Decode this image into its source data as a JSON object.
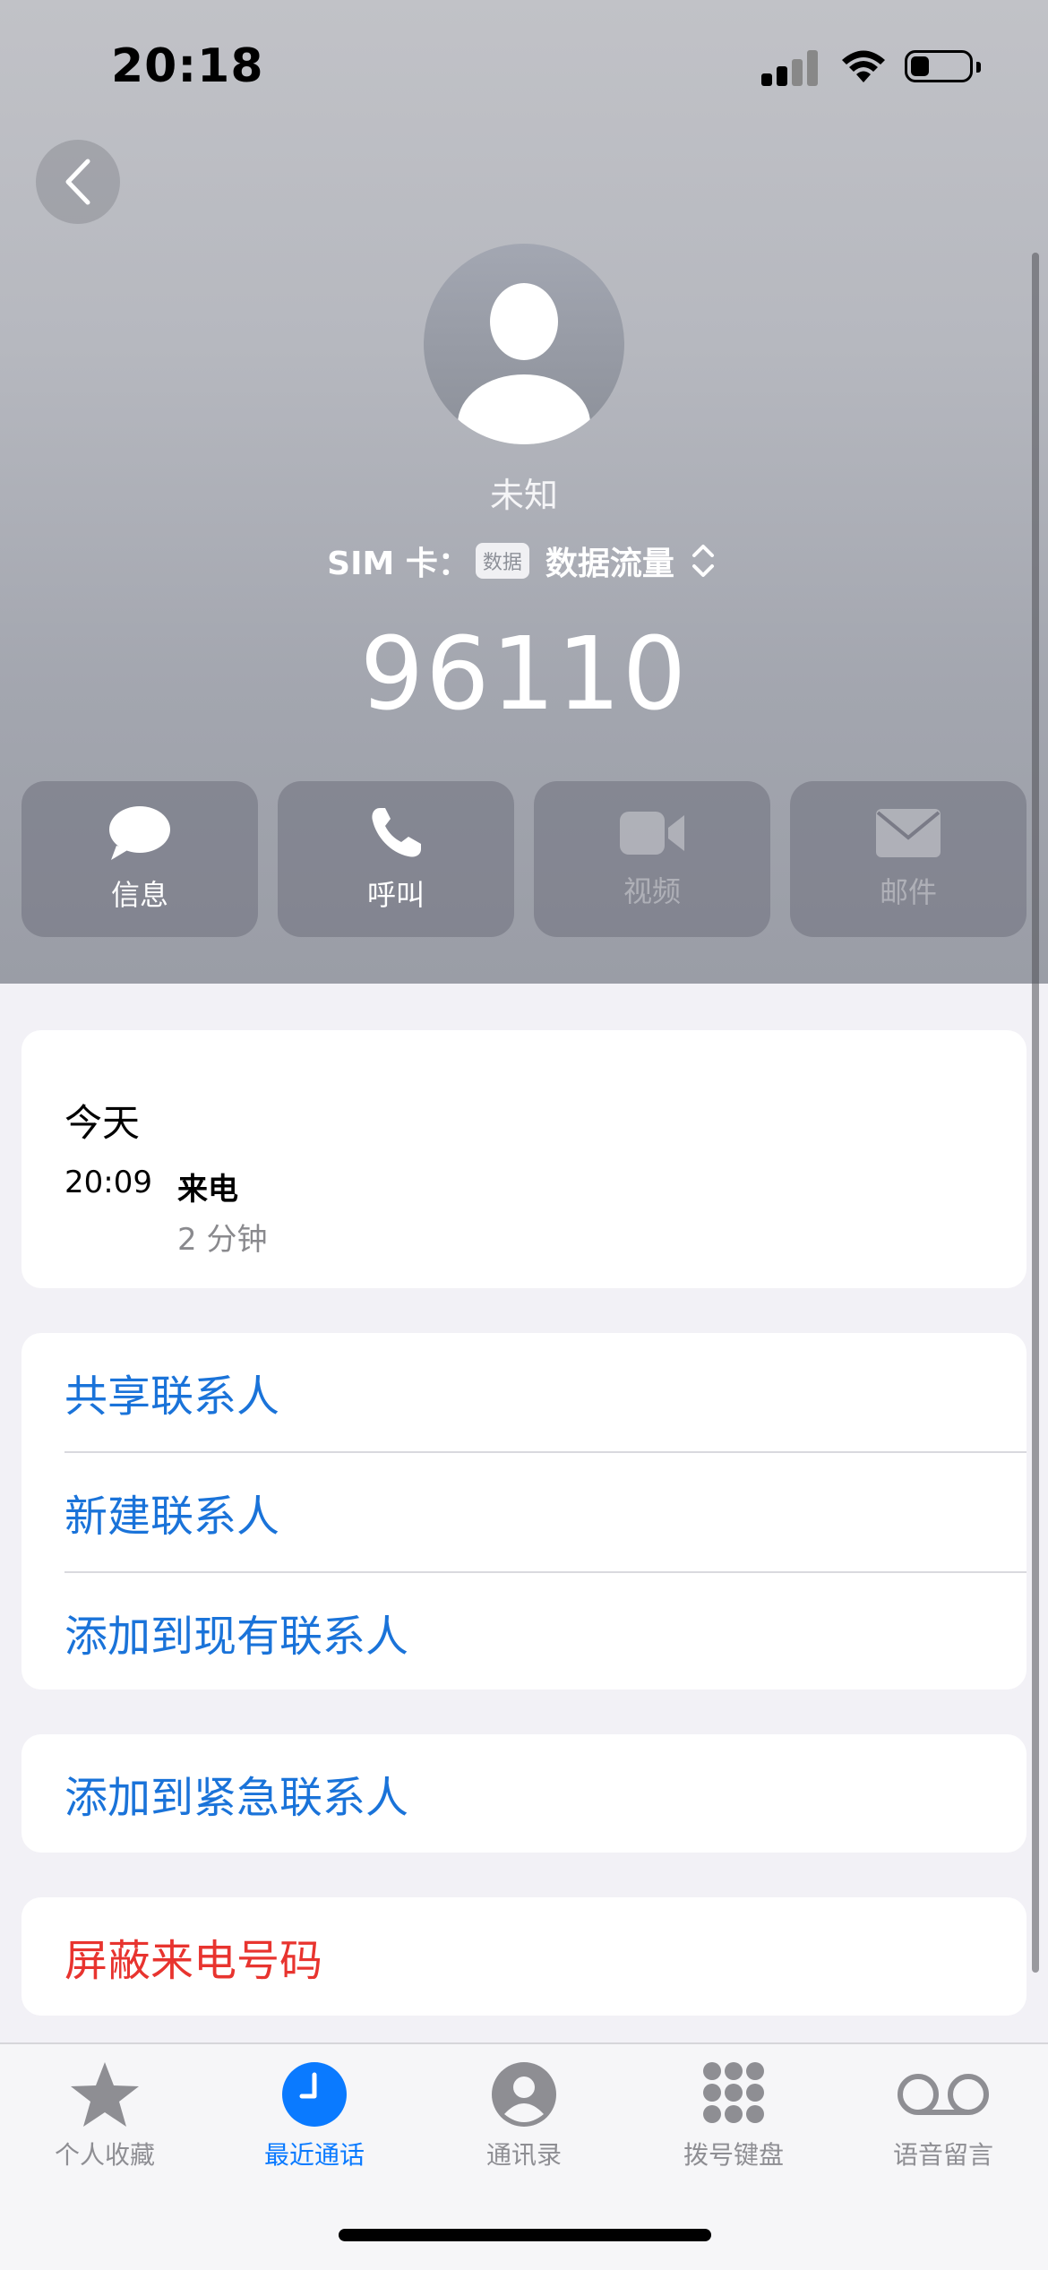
{
  "status_bar": {
    "time": "20:18"
  },
  "contact": {
    "name": "未知",
    "sim_label": "SIM 卡：",
    "sim_badge": "数据",
    "sim_value": "数据流量",
    "number": "96110"
  },
  "actions": [
    {
      "label": "信息",
      "icon": "message-icon",
      "enabled": true
    },
    {
      "label": "呼叫",
      "icon": "phone-icon",
      "enabled": true
    },
    {
      "label": "视频",
      "icon": "video-icon",
      "enabled": false
    },
    {
      "label": "邮件",
      "icon": "mail-icon",
      "enabled": false
    }
  ],
  "history": {
    "date": "今天",
    "time": "20:09",
    "type": "来电",
    "duration": "2 分钟"
  },
  "contact_options": {
    "share": "共享联系人",
    "new": "新建联系人",
    "add_existing": "添加到现有联系人"
  },
  "emergency": {
    "add": "添加到紧急联系人"
  },
  "block": {
    "label": "屏蔽来电号码"
  },
  "tabs": [
    {
      "label": "个人收藏",
      "icon": "star-icon",
      "active": false
    },
    {
      "label": "最近通话",
      "icon": "clock-icon",
      "active": true
    },
    {
      "label": "通讯录",
      "icon": "person-icon",
      "active": false
    },
    {
      "label": "拨号键盘",
      "icon": "keypad-icon",
      "active": false
    },
    {
      "label": "语音留言",
      "icon": "voicemail-icon",
      "active": false
    }
  ],
  "colors": {
    "link": "#1a73d9",
    "destructive": "#e8342f",
    "active_tab": "#0a7aff"
  }
}
